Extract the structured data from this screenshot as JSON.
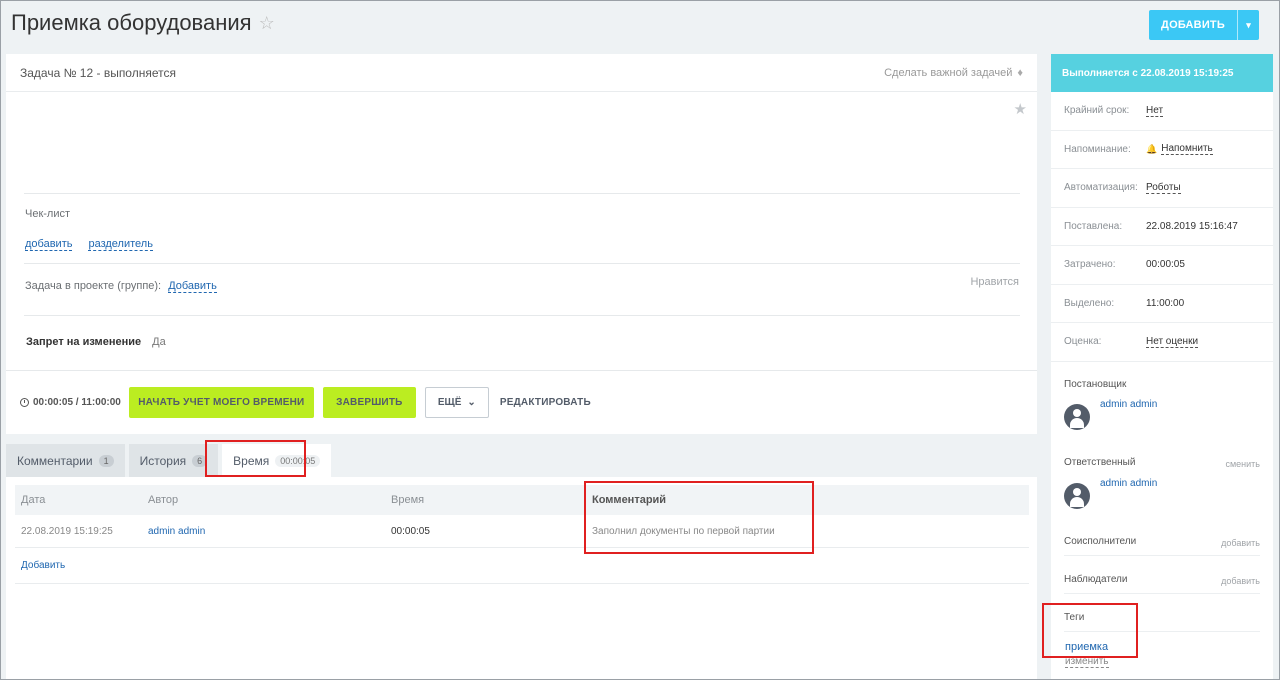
{
  "header": {
    "title": "Приемка оборудования",
    "add_button": "ДОБАВИТЬ"
  },
  "task": {
    "title": "Задача № 12 - выполняется",
    "make_important": "Сделать важной задачей",
    "checklist_label": "Чек-лист",
    "checklist_add": "добавить",
    "checklist_separator": "разделитель",
    "project_label": "Задача в проекте (группе):",
    "project_add": "Добавить",
    "like": "Нравится",
    "ban_label": "Запрет на изменение",
    "ban_value": "Да"
  },
  "footer": {
    "timer": "00:00:05 / 11:00:00",
    "start_time_button": "НАЧАТЬ УЧЕТ МОЕГО ВРЕМЕНИ",
    "finish_button": "ЗАВЕРШИТЬ",
    "more_button": "ЕЩЁ",
    "edit_button": "РЕДАКТИРОВАТЬ"
  },
  "tabs": [
    {
      "label": "Комментарии",
      "count": "1"
    },
    {
      "label": "История",
      "count": "6"
    },
    {
      "label": "Время",
      "count": "00:00:05"
    }
  ],
  "time_table": {
    "columns": [
      "Дата",
      "Автор",
      "Время",
      "Комментарий"
    ],
    "rows": [
      {
        "date": "22.08.2019 15:19:25",
        "author": "admin admin",
        "time": "00:00:05",
        "comment": "Заполнил документы по первой партии"
      }
    ],
    "add_link": "Добавить"
  },
  "sidebar": {
    "status": "Выполняется с 22.08.2019 15:19:25",
    "fields": [
      {
        "key": "Крайний срок:",
        "value": "Нет"
      },
      {
        "key": "Напоминание:",
        "value": "Напомнить"
      },
      {
        "key": "Автоматизация:",
        "value": "Роботы"
      },
      {
        "key": "Поставлена:",
        "value": "22.08.2019 15:16:47"
      },
      {
        "key": "Затрачено:",
        "value": "00:00:05"
      },
      {
        "key": "Выделено:",
        "value": "11:00:00"
      },
      {
        "key": "Оценка:",
        "value": "Нет оценки"
      }
    ],
    "creator_label": "Постановщик",
    "creator_name": "admin admin",
    "responsible_label": "Ответственный",
    "responsible_change": "сменить",
    "responsible_name": "admin admin",
    "coexecutors_label": "Соисполнители",
    "coexecutors_add": "добавить",
    "observers_label": "Наблюдатели",
    "observers_add": "добавить",
    "tags_label": "Теги",
    "tag": "приемка",
    "tags_change": "изменить"
  },
  "colors": {
    "accent": "#3bc8f5",
    "green_button": "#bbed21",
    "status_bar": "#56d1e0",
    "highlight": "#e02020",
    "link": "#2067b0"
  }
}
